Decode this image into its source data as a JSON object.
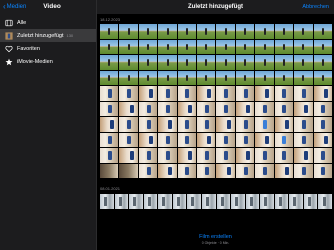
{
  "sidebar": {
    "back_label": "Medien",
    "title": "Video",
    "items": [
      {
        "label": "Alle",
        "count": "",
        "icon": "film-icon"
      },
      {
        "label": "Zuletzt hinzugefügt",
        "count": "130",
        "icon": "thumbnail-icon"
      },
      {
        "label": "Favoriten",
        "count": "",
        "icon": "heart-icon"
      },
      {
        "label": "iMovie-Medien",
        "count": "",
        "icon": "star-icon"
      }
    ]
  },
  "topbar": {
    "title": "Zuletzt hinzugefügt",
    "cancel_label": "Abbrechen"
  },
  "sections": [
    {
      "date": "18.12.2023"
    },
    {
      "date": "08.01.2021"
    }
  ],
  "bottom": {
    "button_label": "Film erstellen",
    "subtitle": "0 Objekte · 0 Min."
  },
  "colors": {
    "accent": "#0a84ff",
    "sidebar_bg": "#1c1c1e",
    "background": "#000000"
  }
}
